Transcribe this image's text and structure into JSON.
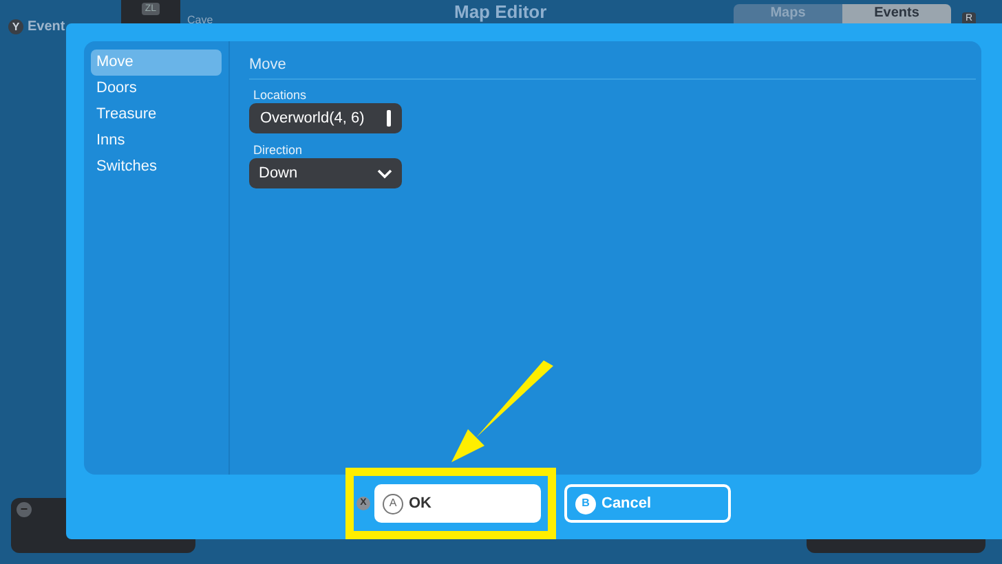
{
  "background": {
    "events_button": {
      "key": "Y",
      "label": "Event"
    },
    "zl_tab": {
      "key": "ZL"
    },
    "location": "Cave",
    "title": "Map Editor",
    "tabs": [
      {
        "label": "Maps",
        "selected": false
      },
      {
        "label": "Events",
        "selected": true
      }
    ],
    "tab_key": "R",
    "bottom_key": "−"
  },
  "dialog": {
    "sidebar": [
      {
        "label": "Move",
        "selected": true
      },
      {
        "label": "Doors",
        "selected": false
      },
      {
        "label": "Treasure",
        "selected": false
      },
      {
        "label": "Inns",
        "selected": false
      },
      {
        "label": "Switches",
        "selected": false
      }
    ],
    "heading": "Move",
    "fields": [
      {
        "kind": "text",
        "label": "Locations",
        "value": "Overworld(4, 6)"
      },
      {
        "kind": "dropdown",
        "label": "Direction",
        "value": "Down"
      }
    ],
    "shortcut": "X",
    "buttons": [
      {
        "key": "A",
        "label": "OK",
        "selected": true
      },
      {
        "key": "B",
        "label": "Cancel",
        "selected": false
      }
    ]
  }
}
